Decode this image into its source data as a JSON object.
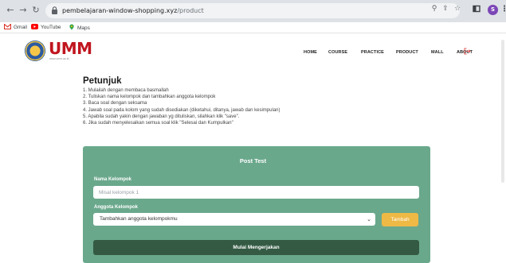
{
  "browser": {
    "url_host": "pembelajaran-window-shopping.xyz",
    "url_path": "/product",
    "profile_initial": "S",
    "bookmarks": [
      {
        "label": "Gmail",
        "icon": "gmail-icon"
      },
      {
        "label": "YouTube",
        "icon": "youtube-icon"
      },
      {
        "label": "Maps",
        "icon": "maps-icon"
      }
    ]
  },
  "site": {
    "logo_text": "UMM",
    "logo_sub": "www.umm.ac.id",
    "menu": [
      "HOME",
      "COURSE",
      "PRACTICE",
      "PRODUCT",
      "MALL",
      "ABOUT"
    ],
    "logout_icon": "logout-icon"
  },
  "instructions": {
    "title": "Petunjuk",
    "steps": [
      "1. Mulailah dengan membaca basmallah",
      "2. Tuliskan nama kelompok dan tambahkan anggota kelompok",
      "3. Baca soal dengan seksama",
      "4. Jawab soal pada kolom yang sudah disediakan (diketahui, ditanya, jawab dan kesimpulan)",
      "5. Apabila sudah yakin dengan jawaban yg dituliskan, silahkan klik \"save\".",
      "6. Jika sudah menyelesaikan semua soal klik \"Selesai dan Kumpulkan\""
    ]
  },
  "form": {
    "title": "Post Test",
    "group_name_label": "Nama Kelompok",
    "group_name_placeholder": "Misal kelompok 1",
    "members_label": "Anggota Kelompok",
    "members_selected": "Tambahkan anggota kelompokmu",
    "add_button": "Tambah",
    "start_button": "Mulai Mengerjakan"
  },
  "colors": {
    "card": "#6aa88c",
    "start_button": "#345a43",
    "add_button": "#efb946",
    "logo": "#c0151e"
  }
}
